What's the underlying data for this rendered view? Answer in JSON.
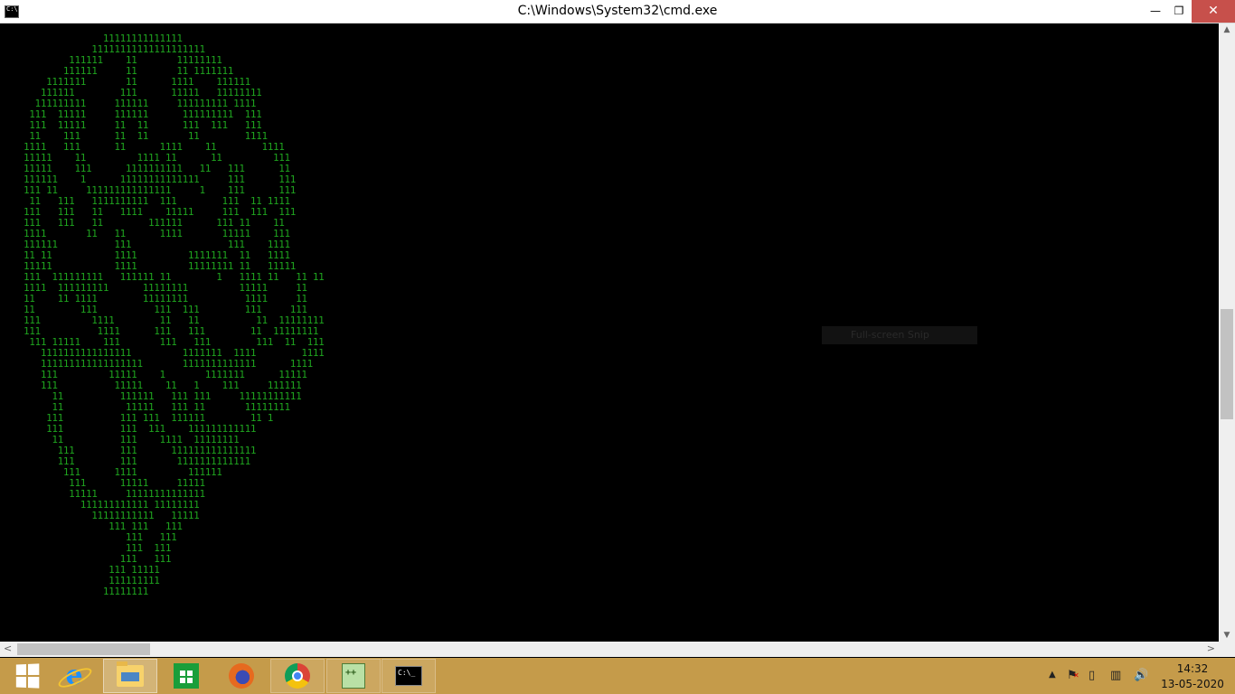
{
  "window": {
    "title": "C:\\Windows\\System32\\cmd.exe",
    "minimize_glyph": "—",
    "maximize_glyph": "❐",
    "close_glyph": "✕"
  },
  "console": {
    "text_color": "#1fa41f",
    "art_lines": [
      "              11111111111111",
      "            11111111111111111111",
      "        111111    11       11111111",
      "       111111     11       11 1111111",
      "    1111111       11      1111    111111",
      "   111111        111      11111   11111111",
      "  111111111     111111     111111111 1111",
      " 111  11111     111111      111111111  111",
      " 111  11111     11  11      111  111   111",
      " 11    111      11  11       11        1111",
      "1111   111      11      1111    11        1111",
      "11111    11         1111 11      11         111",
      "11111    111      1111111111   11   111      11",
      "111111    1      11111111111111     111      111",
      "111 11     111111111111111     1    111      111",
      " 11   111   1111111111  111        111  11 1111",
      "111   111   11   1111    11111     111  111  111",
      "111   111   11        111111      111 11    11",
      "1111       11   11      1111       11111    111",
      "111111          111                 111    1111",
      "11 11           1111         1111111  11   1111",
      "11111           1111         11111111 11   11111",
      "111  111111111   111111 11        1   1111 11   11 11",
      "1111  111111111      11111111         11111     11",
      "11    11 1111        11111111          1111     11",
      "11        111          111  111        111     111",
      "111         1111        11   11          11  11111111",
      "111          1111      111   111        11  11111111",
      " 111 11111    111       111   111        111  11  111",
      "   1111111111111111         1111111  1111        1111",
      "   111111111111111111       1111111111111      1111",
      "   111         11111    1       1111111      11111",
      "   111          11111    11   1    111     111111",
      "     11          111111   111 111     11111111111",
      "     11           11111   111 11       11111111",
      "    111          111 111  111111        11 1",
      "    111          111  111    111111111111",
      "     11          111    1111  11111111",
      "      111        111      111111111111111",
      "      111        111       1111111111111",
      "       111      1111         111111",
      "        111      11111     11111",
      "        11111     11111111111111",
      "          111111111111 11111111",
      "            11111111111   11111",
      "               111 111   111",
      "                  111   111",
      "                  111  111",
      "                 111   111",
      "               111 11111",
      "               111111111",
      "              11111111"
    ],
    "snip_tooltip": "Full-screen Snip"
  },
  "taskbar": {
    "color": "#c59b4a",
    "apps": [
      {
        "name": "start",
        "icon": "windows-logo-icon"
      },
      {
        "name": "internet-explorer",
        "icon": "internet-explorer-icon"
      },
      {
        "name": "file-explorer",
        "icon": "folder-icon"
      },
      {
        "name": "store",
        "icon": "store-icon"
      },
      {
        "name": "firefox",
        "icon": "firefox-icon"
      },
      {
        "name": "chrome",
        "icon": "chrome-icon"
      },
      {
        "name": "notepad-plus-plus",
        "icon": "notepad-plus-plus-icon"
      },
      {
        "name": "command-prompt",
        "icon": "command-prompt-icon"
      }
    ],
    "tray": {
      "overflow_glyph": "▲",
      "flag_glyph": "⚑",
      "device_glyph": "▯",
      "network_glyph": "▥",
      "volume_glyph": "🔊"
    },
    "clock": {
      "time": "14:32",
      "date": "13-05-2020"
    }
  }
}
